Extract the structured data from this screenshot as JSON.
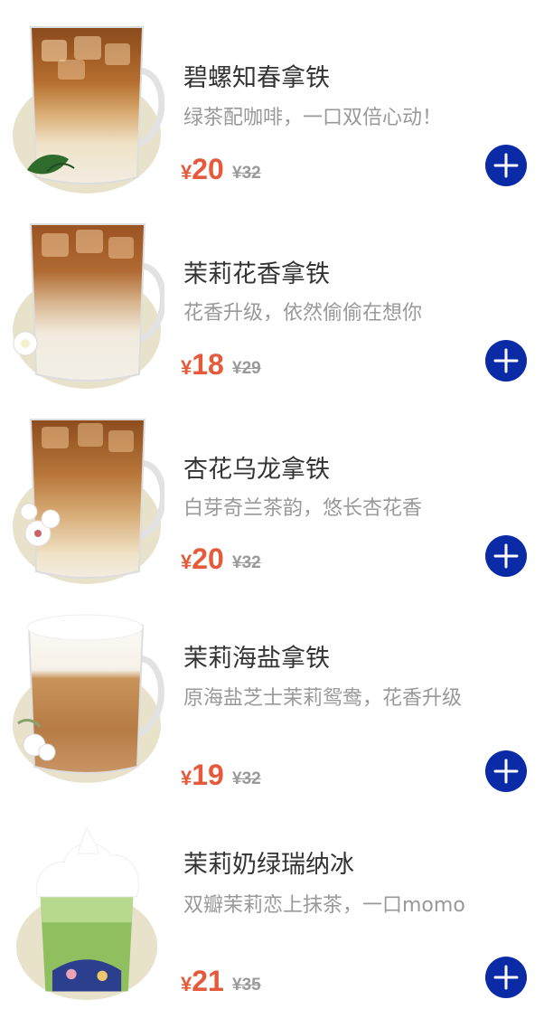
{
  "currency": "¥",
  "colors": {
    "price": "#e45a3a",
    "button": "#0b2aa6",
    "name": "#333333",
    "desc": "#999999"
  },
  "products": [
    {
      "name": "碧螺知春拿铁",
      "desc": "绿茶配咖啡，一口双倍心动！",
      "price": "20",
      "original": "¥32",
      "image": "iced-latte-green-leaf",
      "add_icon": "plus-icon"
    },
    {
      "name": "茉莉花香拿铁",
      "desc": "花香升级，依然偷偷在想你",
      "price": "18",
      "original": "¥29",
      "image": "iced-latte-jasmine",
      "add_icon": "plus-icon"
    },
    {
      "name": "杏花乌龙拿铁",
      "desc": "白芽奇兰茶韵，悠长杏花香",
      "price": "20",
      "original": "¥32",
      "image": "iced-latte-apricot-blossom",
      "add_icon": "plus-icon"
    },
    {
      "name": "茉莉海盐拿铁",
      "desc": "原海盐芝士茉莉鸳鸯，花香升级",
      "price": "19",
      "original": "¥32",
      "image": "sea-salt-foam-latte",
      "add_icon": "plus-icon"
    },
    {
      "name": "茉莉奶绿瑞纳冰",
      "desc": "双瓣茉莉恋上抹茶，一口momo",
      "price": "21",
      "original": "¥35",
      "image": "matcha-frappe",
      "add_icon": "plus-icon"
    }
  ]
}
